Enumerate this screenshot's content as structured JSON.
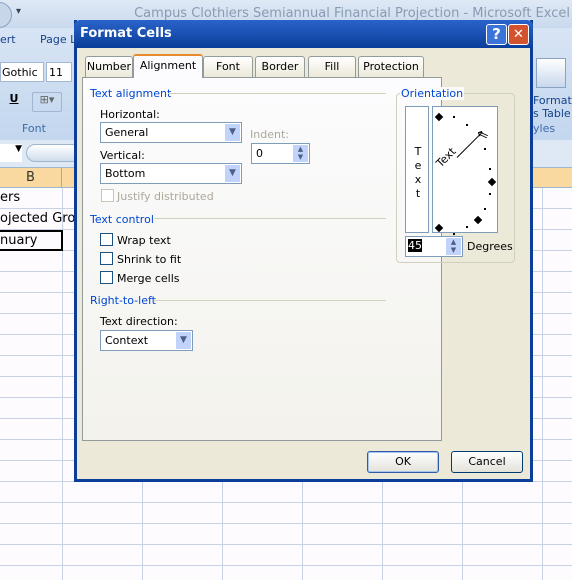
{
  "window_title": "Campus Clothiers Semiannual Financial Projection - Microsoft Excel",
  "ribbon": {
    "tabs": [
      "ert",
      "Page L"
    ],
    "font_name": "Gothic",
    "font_size": "11",
    "groups": {
      "font": "Font",
      "styles": "yles"
    },
    "format_table": [
      "Format",
      "s Table"
    ]
  },
  "sheet": {
    "column_header": "B",
    "cells": [
      "ers",
      "ojected Gro",
      "nuary"
    ]
  },
  "dialog": {
    "title": "Format Cells",
    "help": "?",
    "close": "✕",
    "tabs": [
      "Number",
      "Alignment",
      "Font",
      "Border",
      "Fill",
      "Protection"
    ],
    "active_tab": "Alignment",
    "text_alignment": {
      "heading": "Text alignment",
      "horizontal_label": "Horizontal:",
      "horizontal_value": "General",
      "vertical_label": "Vertical:",
      "vertical_value": "Bottom",
      "indent_label": "Indent:",
      "indent_value": "0",
      "justify_distributed": "Justify distributed"
    },
    "text_control": {
      "heading": "Text control",
      "wrap_text": "Wrap text",
      "shrink_to_fit": "Shrink to fit",
      "merge_cells": "Merge cells"
    },
    "rtl": {
      "heading": "Right-to-left",
      "direction_label": "Text direction:",
      "direction_value": "Context"
    },
    "orientation": {
      "heading": "Orientation",
      "vertical_text": "Text",
      "rotated_text": "Text",
      "degrees_value": "45",
      "degrees_label": "Degrees"
    },
    "ok": "OK",
    "cancel": "Cancel"
  }
}
